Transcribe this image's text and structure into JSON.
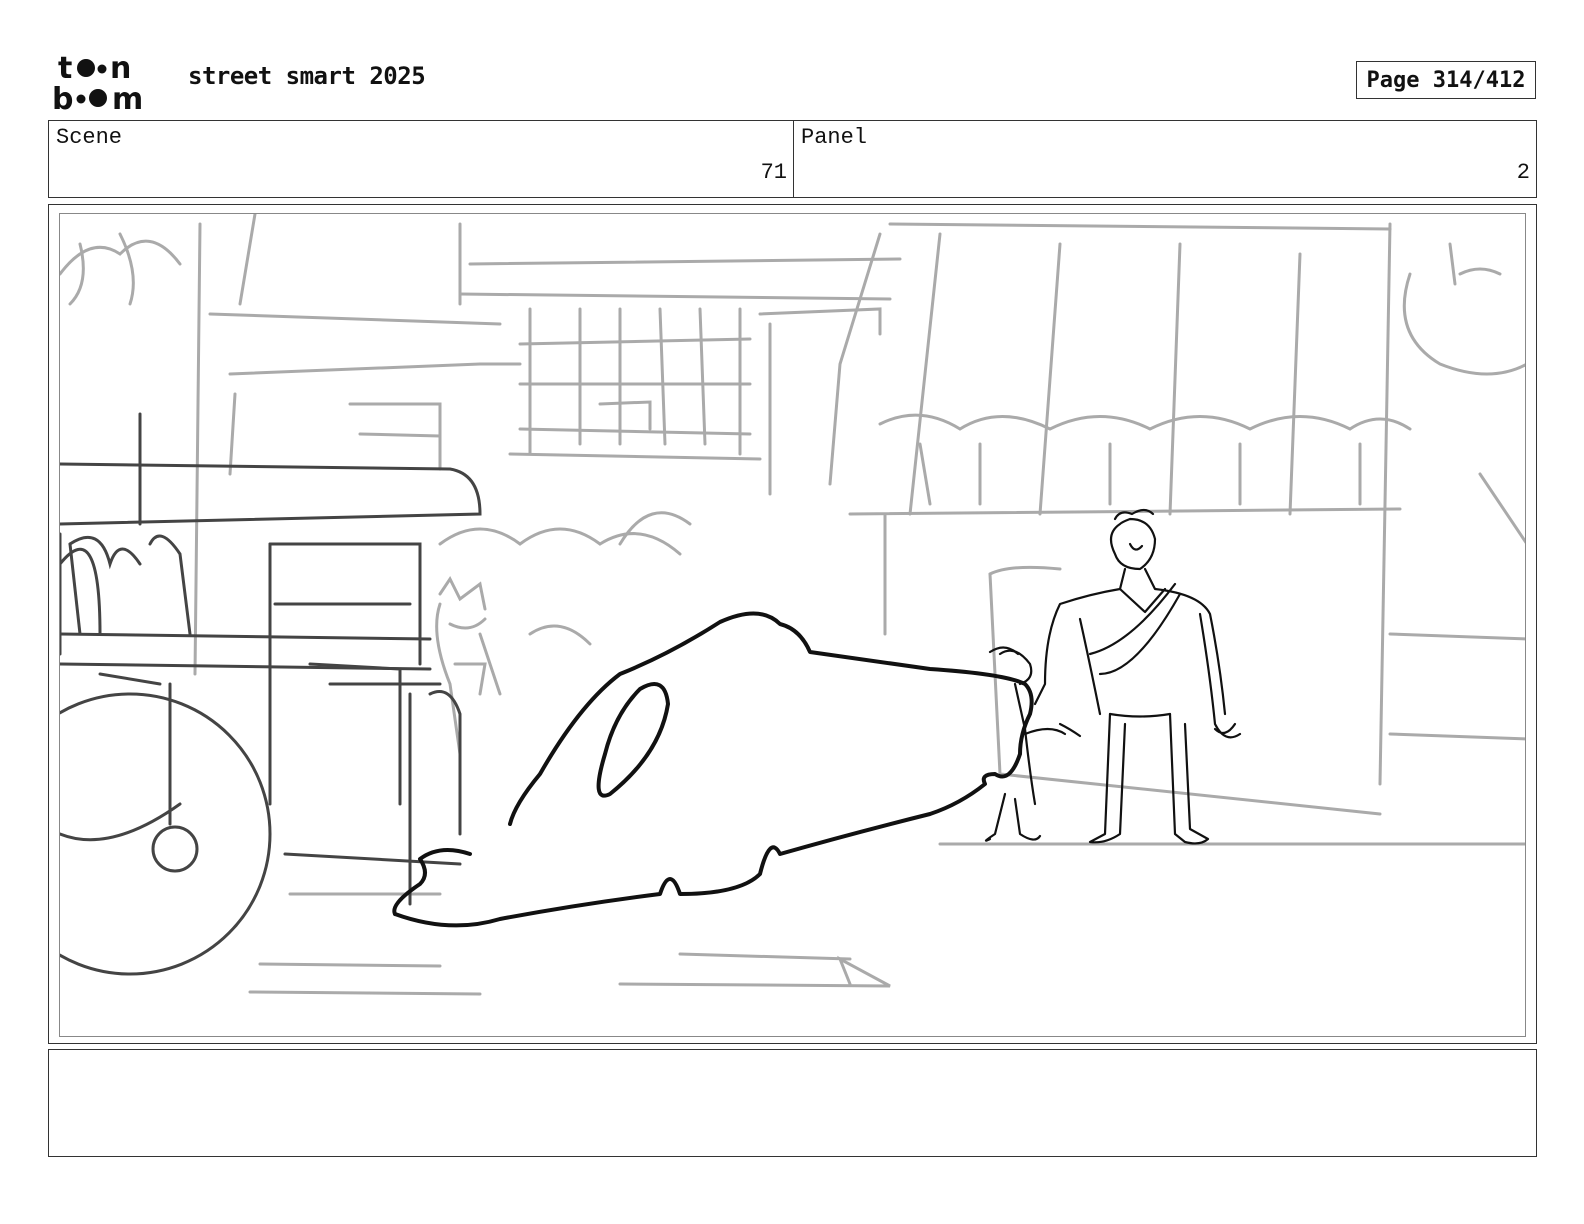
{
  "header": {
    "logo_alt": "toon boom",
    "project_title": "street smart 2025",
    "page_label": "Page 314/412"
  },
  "info": {
    "scene_label": "Scene",
    "scene_value": "71",
    "panel_label": "Panel",
    "panel_value": "2"
  },
  "frame": {
    "description": ""
  },
  "notes": {
    "text": ""
  }
}
